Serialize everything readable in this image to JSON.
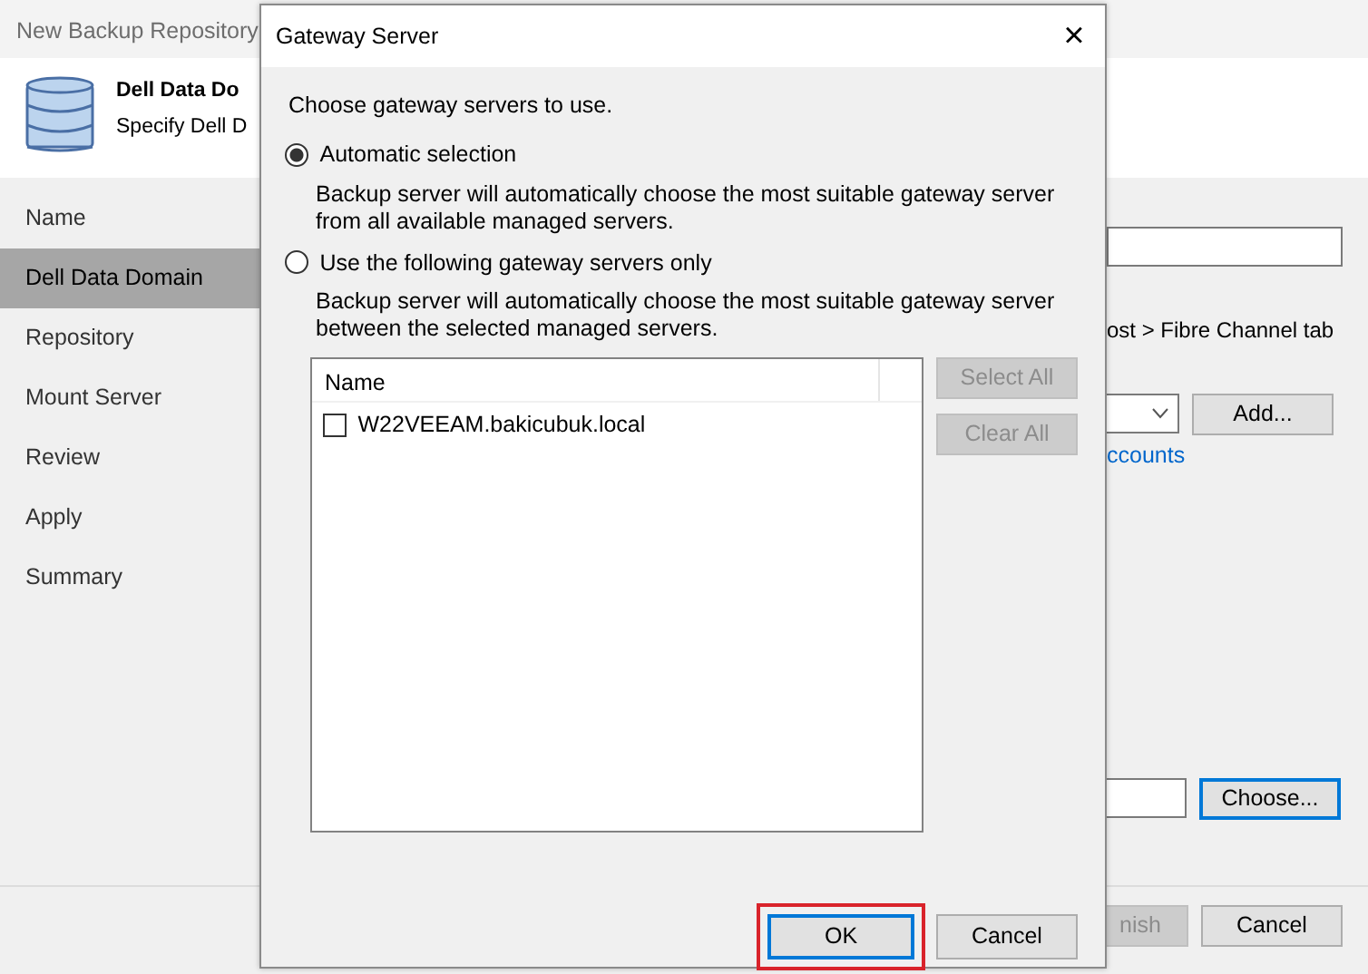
{
  "wizard": {
    "title": "New Backup Repository",
    "header": {
      "title": "Dell Data Do",
      "subtitle": "Specify Dell D"
    },
    "steps": [
      {
        "label": "Name",
        "selected": false
      },
      {
        "label": "Dell Data Domain",
        "selected": true
      },
      {
        "label": "Repository",
        "selected": false
      },
      {
        "label": "Mount Server",
        "selected": false
      },
      {
        "label": "Review",
        "selected": false
      },
      {
        "label": "Apply",
        "selected": false
      },
      {
        "label": "Summary",
        "selected": false
      }
    ],
    "content": {
      "hint": "ost > Fibre Channel tab",
      "add_button": "Add...",
      "link": "ccounts",
      "choose_button": "Choose..."
    },
    "footer_buttons": [
      {
        "label": "nish",
        "disabled": true
      },
      {
        "label": "Cancel",
        "disabled": false
      }
    ]
  },
  "dialog": {
    "title": "Gateway Server",
    "close": "×",
    "prompt": "Choose gateway servers to use.",
    "options": [
      {
        "label": "Automatic selection",
        "description": "Backup server will automatically choose the most suitable gateway server from all available managed servers.",
        "selected": true
      },
      {
        "label": "Use the following gateway servers only",
        "description": "Backup server will automatically choose the most suitable gateway server between the selected managed servers.",
        "selected": false
      }
    ],
    "list": {
      "columns": [
        "Name"
      ],
      "rows": [
        {
          "name": "W22VEEAM.bakicubuk.local",
          "checked": false
        }
      ]
    },
    "side_buttons": [
      {
        "label": "Select All",
        "disabled": true
      },
      {
        "label": "Clear All",
        "disabled": true
      }
    ],
    "buttons": [
      {
        "label": "OK",
        "default": true,
        "highlighted": true
      },
      {
        "label": "Cancel",
        "default": false,
        "highlighted": false
      }
    ]
  }
}
